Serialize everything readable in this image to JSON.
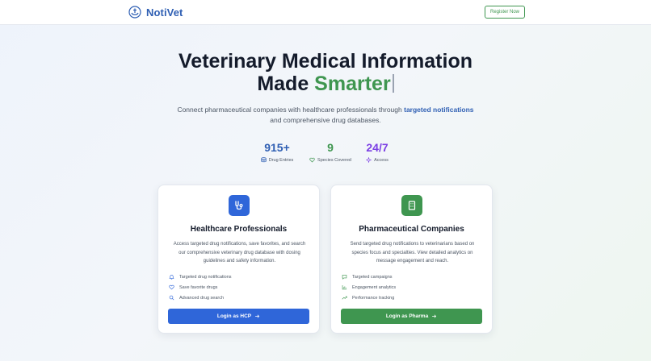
{
  "header": {
    "brand_name": "NotiVet",
    "register_label": "Register Now"
  },
  "hero": {
    "title_line1": "Veterinary Medical Information",
    "title_line2_prefix": "Made ",
    "title_line2_accent": "Smarter",
    "subtitle_line1_before": "Connect pharmaceutical companies with healthcare professionals through ",
    "subtitle_highlight": "targeted notifications",
    "subtitle_line2": "and comprehensive drug databases."
  },
  "stats": [
    {
      "value": "915+",
      "label": "Drug Entries",
      "icon": "database-icon",
      "color": "#2f5fb3"
    },
    {
      "value": "9",
      "label": "Species Covered",
      "icon": "heart-icon",
      "color": "#3f9650"
    },
    {
      "value": "24/7",
      "label": "Access",
      "icon": "sparkle-icon",
      "color": "#7b3fe4"
    }
  ],
  "cards": [
    {
      "title": "Healthcare Professionals",
      "icon": "stethoscope-icon",
      "accent": "#2f66d9",
      "description": "Access targeted drug notifications, save favorites, and search our comprehensive veterinary drug database with dosing guidelines and safety information.",
      "features": [
        {
          "label": "Targeted drug notifications",
          "icon": "bell-icon"
        },
        {
          "label": "Save favorite drugs",
          "icon": "heart-icon"
        },
        {
          "label": "Advanced drug search",
          "icon": "search-icon"
        }
      ],
      "button_label": "Login as HCP"
    },
    {
      "title": "Pharmaceutical Companies",
      "icon": "building-icon",
      "accent": "#3f9650",
      "description": "Send targeted drug notifications to veterinarians based on species focus and specialties. View detailed analytics on message engagement and reach.",
      "features": [
        {
          "label": "Targeted campaigns",
          "icon": "message-icon"
        },
        {
          "label": "Engagement analytics",
          "icon": "bar-chart-icon"
        },
        {
          "label": "Performance tracking",
          "icon": "trending-up-icon"
        }
      ],
      "button_label": "Login as Pharma"
    }
  ]
}
